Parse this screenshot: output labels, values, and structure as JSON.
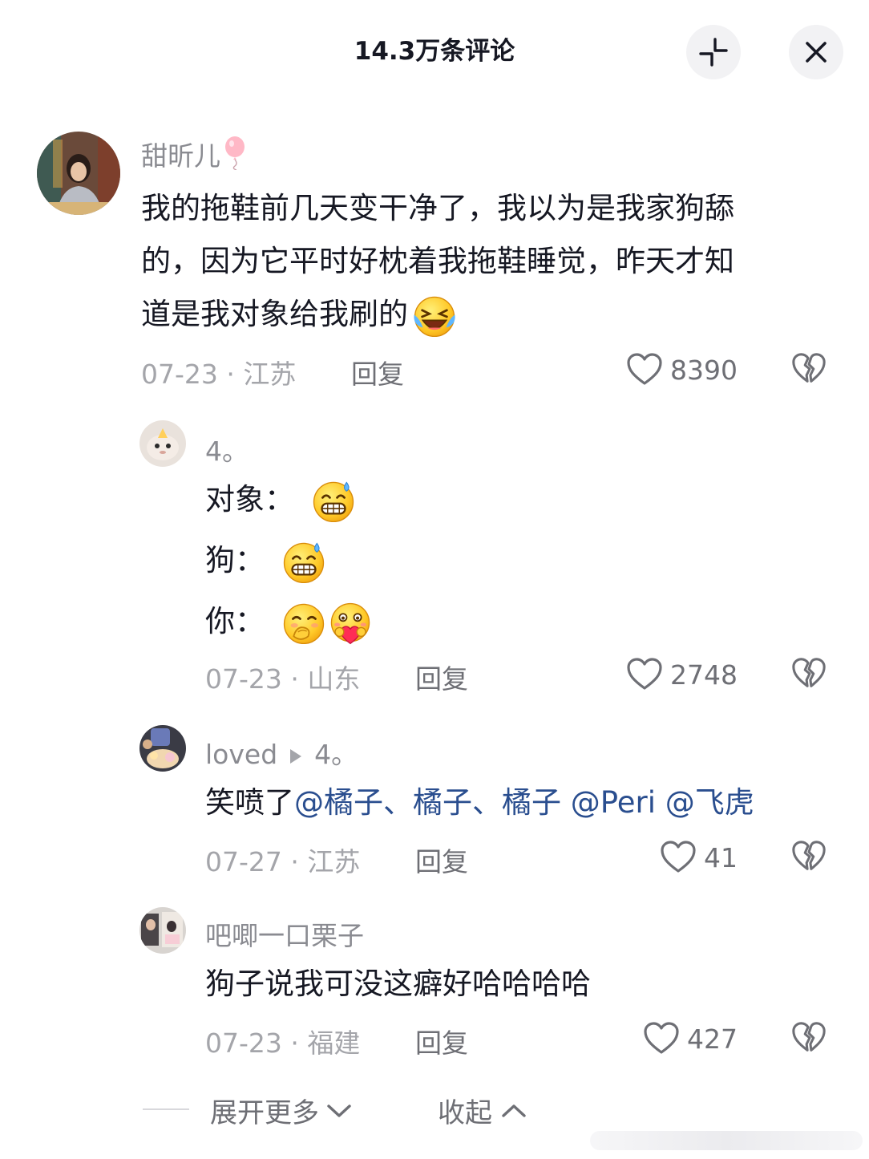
{
  "header": {
    "title": "14.3万条评论"
  },
  "comments": [
    {
      "username": "甜昕儿",
      "badge_icon": "balloon-icon",
      "text_lines": [
        "我的拖鞋前几天变干净了，我以为是我家狗舔",
        "的，因为它平时好枕着我拖鞋睡觉，昨天才知",
        "道是我对象给我刷的"
      ],
      "emoji": "laughing-crying-emoji",
      "meta": "07-23 · 江苏",
      "reply_label": "回复",
      "likes": "8390"
    },
    {
      "username": "4。",
      "lines": [
        {
          "text": "对象：",
          "emojis": [
            "grinning-sweat-emoji"
          ]
        },
        {
          "text": "狗：",
          "emojis": [
            "grinning-sweat-emoji"
          ]
        },
        {
          "text": "你：",
          "emojis": [
            "hand-over-mouth-emoji",
            "hugging-heart-emoji"
          ]
        }
      ],
      "meta": "07-23 · 山东",
      "reply_label": "回复",
      "likes": "2748"
    },
    {
      "username": "loved",
      "reply_to": "4。",
      "text": "笑喷了",
      "mentions": "@橘子、橘子、橘子 @Peri @飞虎",
      "meta": "07-27 · 江苏",
      "reply_label": "回复",
      "likes": "41"
    },
    {
      "username": "吧唧一口栗子",
      "text": "狗子说我可没这癖好哈哈哈哈",
      "meta": "07-23 · 福建",
      "reply_label": "回复",
      "likes": "427"
    }
  ],
  "footer": {
    "expand_label": "展开更多",
    "collapse_label": "收起"
  },
  "colors": {
    "mention": "#2a4e8f",
    "meta": "#a4a5aa",
    "text": "#161823"
  }
}
